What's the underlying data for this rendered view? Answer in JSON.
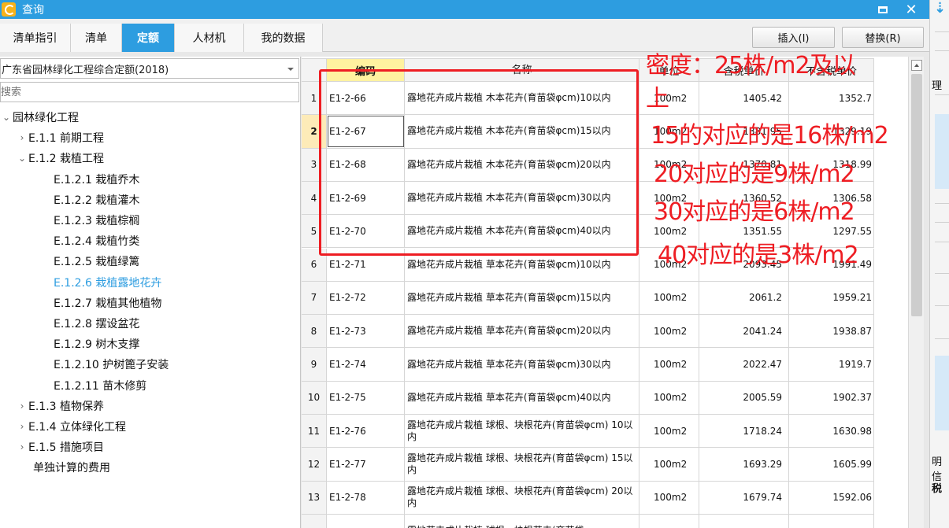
{
  "window": {
    "title": "查询"
  },
  "tabs": [
    "清单指引",
    "清单",
    "定额",
    "人材机",
    "我的数据"
  ],
  "active_tab": 2,
  "actions": {
    "insert": "插入(I)",
    "replace": "替换(R)"
  },
  "left": {
    "dropdown_value": "广东省园林绿化工程综合定额(2018)",
    "search_placeholder": "搜索",
    "tree": [
      {
        "label": "园林绿化工程",
        "chevron": "⌄",
        "indent": 0
      },
      {
        "label": "E.1.1 前期工程",
        "chevron": "›",
        "indent": 1
      },
      {
        "label": "E.1.2 栽植工程",
        "chevron": "⌄",
        "indent": 1
      },
      {
        "label": "E.1.2.1 栽植乔木",
        "chevron": "",
        "indent": 2
      },
      {
        "label": "E.1.2.2 栽植灌木",
        "chevron": "",
        "indent": 2
      },
      {
        "label": "E.1.2.3 栽植棕榈",
        "chevron": "",
        "indent": 2
      },
      {
        "label": "E.1.2.4 栽植竹类",
        "chevron": "",
        "indent": 2
      },
      {
        "label": "E.1.2.5 栽植绿篱",
        "chevron": "",
        "indent": 2
      },
      {
        "label": "E.1.2.6 栽植露地花卉",
        "chevron": "",
        "indent": 2,
        "selected": true
      },
      {
        "label": "E.1.2.7 栽植其他植物",
        "chevron": "",
        "indent": 2
      },
      {
        "label": "E.1.2.8 摆设盆花",
        "chevron": "",
        "indent": 2
      },
      {
        "label": "E.1.2.9 树木支撑",
        "chevron": "",
        "indent": 2
      },
      {
        "label": "E.1.2.10 护树篦子安装",
        "chevron": "",
        "indent": 2
      },
      {
        "label": "E.1.2.11 苗木修剪",
        "chevron": "",
        "indent": 2
      },
      {
        "label": "E.1.3 植物保养",
        "chevron": "›",
        "indent": 1
      },
      {
        "label": "E.1.4 立体绿化工程",
        "chevron": "›",
        "indent": 1
      },
      {
        "label": "E.1.5 措施项目",
        "chevron": "›",
        "indent": 1
      },
      {
        "label": "单独计算的费用",
        "chevron": "",
        "indent": 1.5
      }
    ]
  },
  "grid": {
    "headers": {
      "code": "编码",
      "name": "名称",
      "unit": "单位",
      "tax": "含税单价",
      "notax": "不含税单价"
    },
    "selected_row": 2,
    "rows": [
      {
        "no": "1",
        "code": "E1-2-66",
        "name": "露地花卉成片栽植 木本花卉(育苗袋φcm)10以内",
        "unit": "100m2",
        "tax": "1405.42",
        "notax": "1352.7"
      },
      {
        "no": "2",
        "code": "E1-2-67",
        "name": "露地花卉成片栽植 木本花卉(育苗袋φcm)15以内",
        "unit": "100m2",
        "tax": "1381.95",
        "notax": "1329.19"
      },
      {
        "no": "3",
        "code": "E1-2-68",
        "name": "露地花卉成片栽植 木本花卉(育苗袋φcm)20以内",
        "unit": "100m2",
        "tax": "1370.81",
        "notax": "1318.99"
      },
      {
        "no": "4",
        "code": "E1-2-69",
        "name": "露地花卉成片栽植 木本花卉(育苗袋φcm)30以内",
        "unit": "100m2",
        "tax": "1360.52",
        "notax": "1306.58"
      },
      {
        "no": "5",
        "code": "E1-2-70",
        "name": "露地花卉成片栽植 木本花卉(育苗袋φcm)40以内",
        "unit": "100m2",
        "tax": "1351.55",
        "notax": "1297.55"
      },
      {
        "no": "6",
        "code": "E1-2-71",
        "name": "露地花卉成片栽植 草本花卉(育苗袋φcm)10以内",
        "unit": "100m2",
        "tax": "2093.45",
        "notax": "1991.49"
      },
      {
        "no": "7",
        "code": "E1-2-72",
        "name": "露地花卉成片栽植 草本花卉(育苗袋φcm)15以内",
        "unit": "100m2",
        "tax": "2061.2",
        "notax": "1959.21"
      },
      {
        "no": "8",
        "code": "E1-2-73",
        "name": "露地花卉成片栽植 草本花卉(育苗袋φcm)20以内",
        "unit": "100m2",
        "tax": "2041.24",
        "notax": "1938.87"
      },
      {
        "no": "9",
        "code": "E1-2-74",
        "name": "露地花卉成片栽植 草本花卉(育苗袋φcm)30以内",
        "unit": "100m2",
        "tax": "2022.47",
        "notax": "1919.7"
      },
      {
        "no": "10",
        "code": "E1-2-75",
        "name": "露地花卉成片栽植 草本花卉(育苗袋φcm)40以内",
        "unit": "100m2",
        "tax": "2005.59",
        "notax": "1902.37"
      },
      {
        "no": "11",
        "code": "E1-2-76",
        "name": "露地花卉成片栽植 球根、块根花卉(育苗袋φcm) 10以内",
        "unit": "100m2",
        "tax": "1718.24",
        "notax": "1630.98"
      },
      {
        "no": "12",
        "code": "E1-2-77",
        "name": "露地花卉成片栽植 球根、块根花卉(育苗袋φcm) 15以内",
        "unit": "100m2",
        "tax": "1693.29",
        "notax": "1605.99"
      },
      {
        "no": "13",
        "code": "E1-2-78",
        "name": "露地花卉成片栽植 球根、块根花卉(育苗袋φcm) 20以内",
        "unit": "100m2",
        "tax": "1679.74",
        "notax": "1592.06"
      },
      {
        "no": "",
        "code": "",
        "name": "露地花卉成片栽植 球根、块根花卉(育苗袋",
        "unit": "",
        "tax": "",
        "notax": ""
      }
    ]
  },
  "annotations": [
    "密度：25株/m2及以",
    "上",
    "15的对应的是16株/m2",
    "20对应的是9株/m2",
    "30对应的是6株/m2",
    "40对应的是3株/m2"
  ],
  "background_window": {
    "text1": "理",
    "text2": "明信",
    "text3": "税"
  },
  "colors": {
    "accent": "#2d9de0",
    "annotation": "#ee1d23",
    "header_highlight": "#fff2a0"
  }
}
